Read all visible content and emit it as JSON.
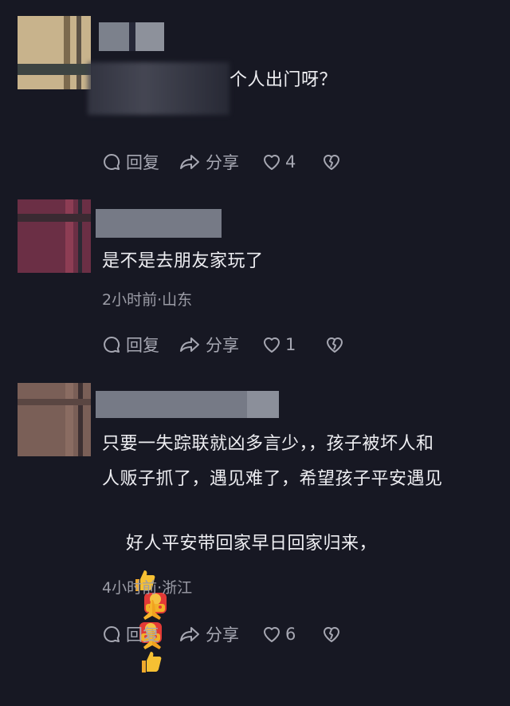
{
  "comments": [
    {
      "text": "个人出门呀？",
      "meta": "",
      "actions": {
        "reply": "回复",
        "share": "分享",
        "likes": "4"
      }
    },
    {
      "text": "是不是去朋友家玩了",
      "meta": "2小时前·山东",
      "actions": {
        "reply": "回复",
        "share": "分享",
        "likes": "1"
      }
    },
    {
      "text_line1": "只要一失踪联就凶多言少，，孩子被坏人和",
      "text_line2": "人贩子抓了，遇见难了，希望孩子平安遇见",
      "text_line3": "好人平安带回家早日回家归来，",
      "meta": "4小时前·浙江",
      "actions": {
        "reply": "回复",
        "share": "分享",
        "likes": "6"
      }
    }
  ],
  "icons": {
    "reply": "comment-bubble-icon",
    "share": "share-arrow-icon",
    "like": "heart-icon",
    "dislike": "broken-heart-icon",
    "emoji_hongbao": "red-envelope-emoji",
    "emoji_thumb": "thumbs-up-emoji",
    "emoji_pray": "praying-hands-emoji"
  },
  "colors": {
    "background": "#171823",
    "text": "#eeeef2",
    "meta": "#9b9ca6",
    "action": "#a6a7b2"
  }
}
